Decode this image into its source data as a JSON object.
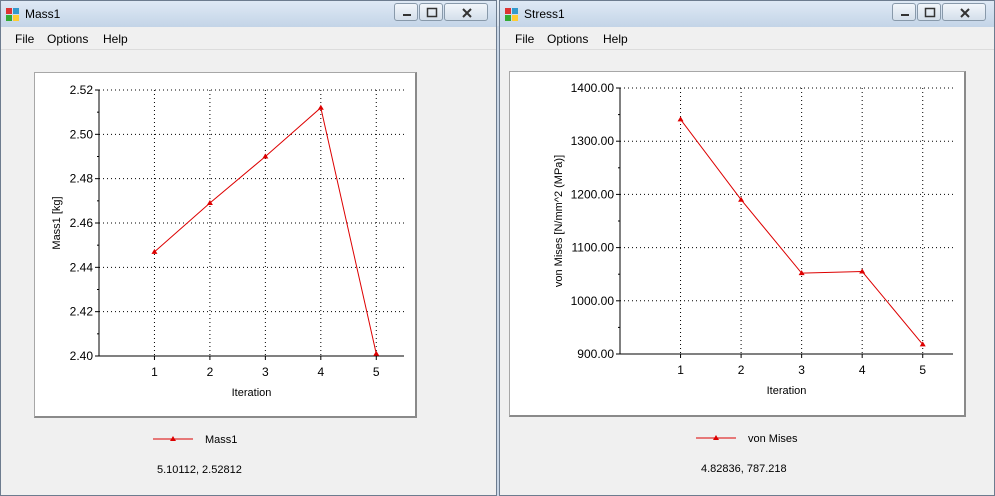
{
  "windows": [
    {
      "title": "Mass1",
      "menu": [
        "File",
        "Options",
        "Help"
      ],
      "legend_label": "Mass1",
      "coords_readout": "5.10112, 2.52812",
      "chart_data": {
        "type": "line",
        "x": [
          1,
          2,
          3,
          4,
          5
        ],
        "series": [
          {
            "name": "Mass1",
            "values": [
              2.447,
              2.469,
              2.49,
              2.512,
              2.401
            ],
            "color": "#dd0000",
            "marker": "triangle"
          }
        ],
        "xlabel": "Iteration",
        "ylabel": "Mass1 [kg]",
        "xlim": [
          0.0,
          5.5
        ],
        "ylim": [
          2.4,
          2.52
        ],
        "xticks": [
          "1",
          "2",
          "3",
          "4",
          "5"
        ],
        "yticks": [
          "2.40",
          "2.42",
          "2.44",
          "2.46",
          "2.48",
          "2.50",
          "2.52"
        ],
        "grid": true,
        "grid_style": "dotted",
        "legend_position": "bottom"
      }
    },
    {
      "title": "Stress1",
      "menu": [
        "File",
        "Options",
        "Help"
      ],
      "legend_label": "von Mises",
      "coords_readout": "4.82836, 787.218",
      "chart_data": {
        "type": "line",
        "x": [
          1,
          2,
          3,
          4,
          5
        ],
        "series": [
          {
            "name": "von Mises",
            "values": [
              1341,
              1190,
              1052,
              1055,
              918
            ],
            "color": "#dd0000",
            "marker": "triangle"
          }
        ],
        "xlabel": "Iteration",
        "ylabel": "von Mises [N/mm^2 (MPa)]",
        "xlim": [
          0.0,
          5.5
        ],
        "ylim": [
          900,
          1400
        ],
        "xticks": [
          "1",
          "2",
          "3",
          "4",
          "5"
        ],
        "yticks": [
          "900.00",
          "1000.00",
          "1100.00",
          "1200.00",
          "1300.00",
          "1400.00"
        ],
        "grid": true,
        "grid_style": "dotted",
        "legend_position": "bottom"
      }
    }
  ],
  "icons": {
    "app": "app-icon",
    "minimize": "minimize-icon",
    "maximize": "maximize-icon",
    "close": "close-icon"
  }
}
